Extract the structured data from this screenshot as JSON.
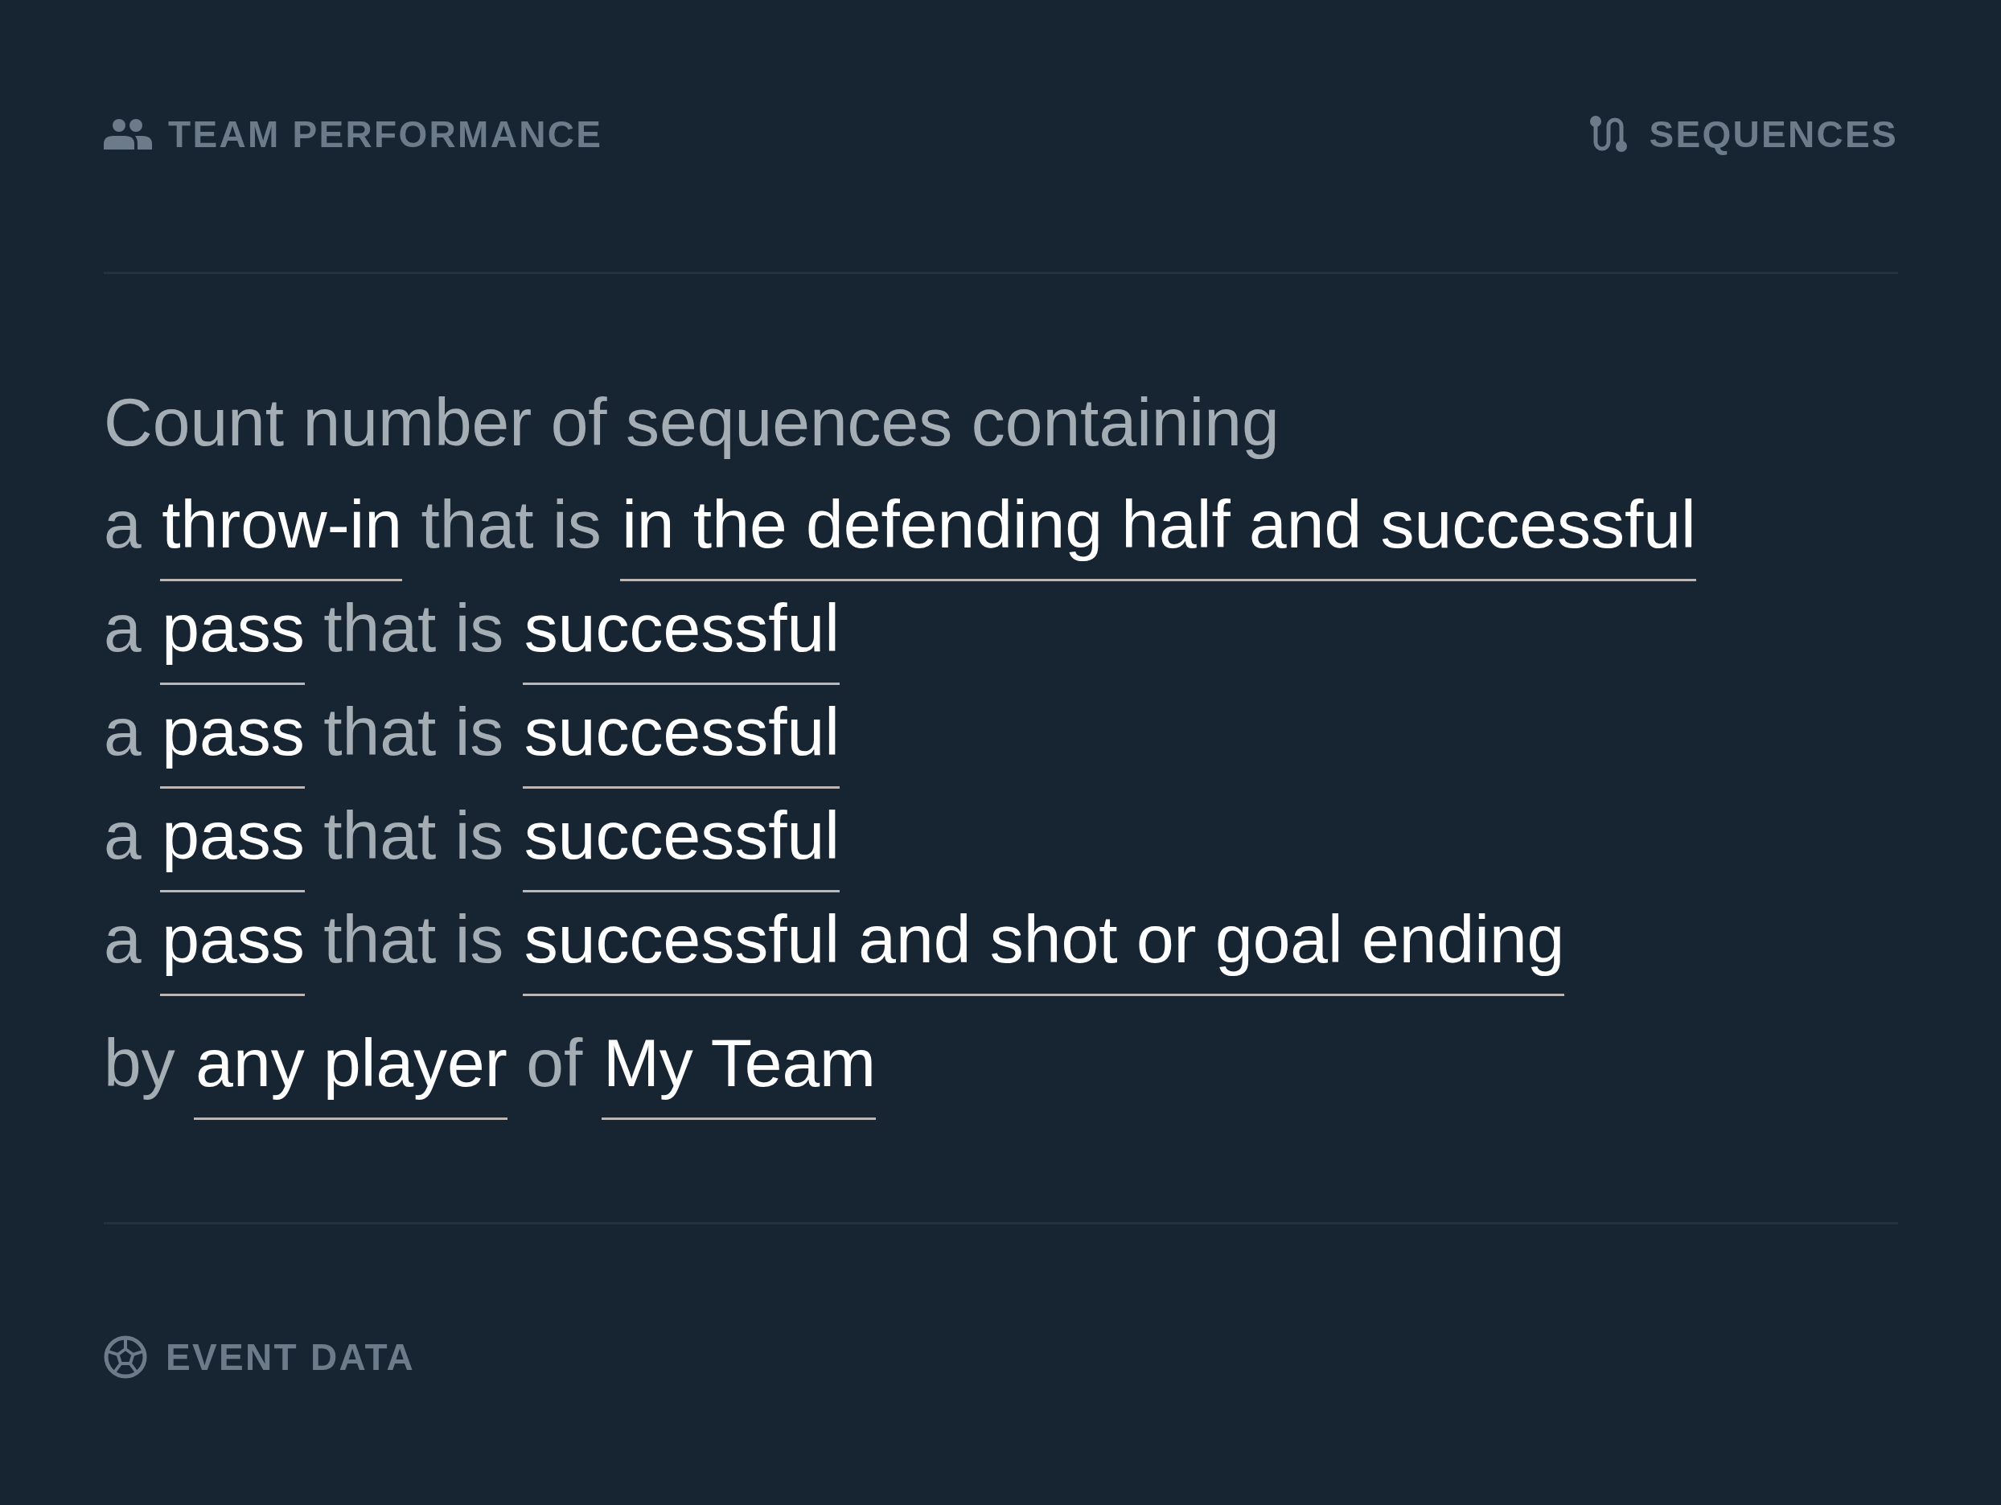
{
  "header": {
    "category": "TEAM PERFORMANCE",
    "mode": "SEQUENCES"
  },
  "query": {
    "intro": "Count number of sequences containing",
    "steps": [
      {
        "article": "a",
        "event": "throw-in",
        "connector": "that is",
        "condition": "in the defending half and successful"
      },
      {
        "article": "a",
        "event": "pass",
        "connector": "that is",
        "condition": "successful"
      },
      {
        "article": "a",
        "event": "pass",
        "connector": "that is",
        "condition": "successful"
      },
      {
        "article": "a",
        "event": "pass",
        "connector": "that is",
        "condition": "successful"
      },
      {
        "article": "a",
        "event": "pass",
        "connector": "that is",
        "condition": "successful and shot or goal ending"
      }
    ],
    "subject": {
      "prefix": "by",
      "player": "any player",
      "connector": "of",
      "team": "My Team"
    }
  },
  "footer": {
    "source": "EVENT DATA"
  }
}
